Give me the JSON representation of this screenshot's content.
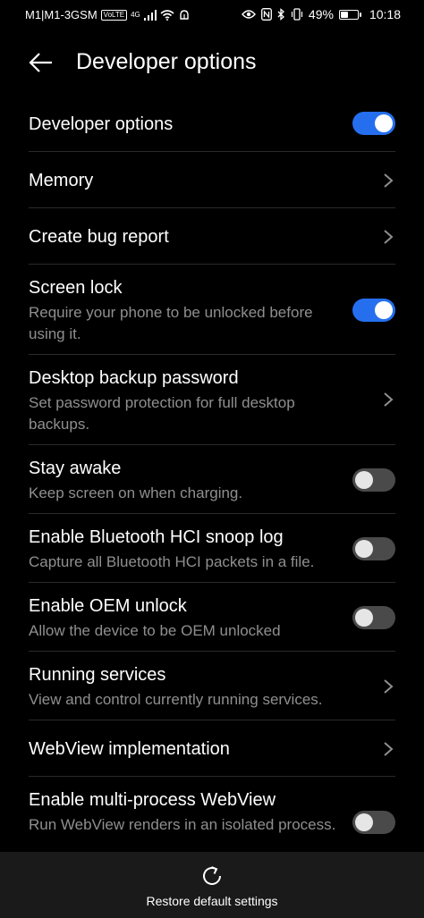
{
  "status_bar": {
    "carrier": "M1|M1-3GSM",
    "volte": "VoLTE",
    "network": "4G",
    "battery_percent_text": "49%",
    "battery_level": 0.49,
    "time": "10:18"
  },
  "header": {
    "title": "Developer options"
  },
  "rows": [
    {
      "title": "Developer options",
      "subtitle": "",
      "control": "toggle",
      "state": "on"
    },
    {
      "title": "Memory",
      "subtitle": "",
      "control": "chevron"
    },
    {
      "title": "Create bug report",
      "subtitle": "",
      "control": "chevron"
    },
    {
      "title": "Screen lock",
      "subtitle": "Require your phone to be unlocked before using it.",
      "control": "toggle",
      "state": "on"
    },
    {
      "title": "Desktop backup password",
      "subtitle": "Set password protection for full desktop backups.",
      "control": "chevron"
    },
    {
      "title": "Stay awake",
      "subtitle": "Keep screen on when charging.",
      "control": "toggle",
      "state": "off"
    },
    {
      "title": "Enable Bluetooth HCI snoop log",
      "subtitle": "Capture all Bluetooth HCI packets in a file.",
      "control": "toggle",
      "state": "off"
    },
    {
      "title": "Enable OEM unlock",
      "subtitle": "Allow the device to be OEM unlocked",
      "control": "toggle",
      "state": "off"
    },
    {
      "title": "Running services",
      "subtitle": "View and control currently running services.",
      "control": "chevron"
    },
    {
      "title": "WebView implementation",
      "subtitle": "",
      "control": "chevron"
    },
    {
      "title": "Enable multi-process WebView",
      "subtitle": "Run WebView renders in an isolated process.",
      "control": "toggle",
      "state": "off"
    }
  ],
  "bottom": {
    "restore_label": "Restore default settings",
    "icon": "refresh-icon"
  },
  "colors": {
    "accent": "#256fef",
    "background": "#000000",
    "subtitle": "#8f8f8f",
    "toggle_off": "#4a4a4a"
  }
}
